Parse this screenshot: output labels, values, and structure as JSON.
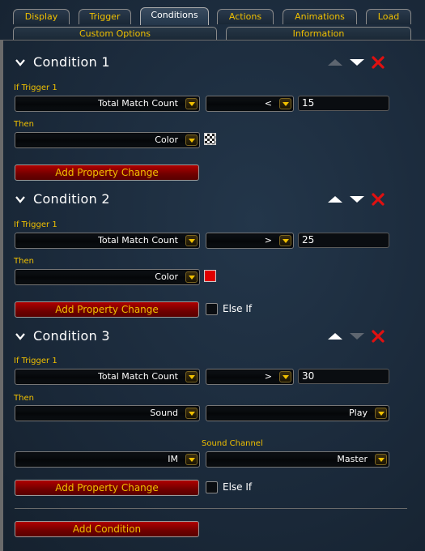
{
  "tabs": [
    "Display",
    "Trigger",
    "Conditions",
    "Actions",
    "Animations",
    "Load"
  ],
  "subtabs": [
    "Custom Options",
    "Information"
  ],
  "conditions": [
    {
      "title": "Condition 1",
      "if_label": "If Trigger 1",
      "check": "Total Match Count",
      "operator": "<",
      "value": "15",
      "then_label": "Then",
      "property": "Color",
      "swatch": "checker",
      "add_label": "Add Property Change"
    },
    {
      "title": "Condition 2",
      "if_label": "If Trigger 1",
      "check": "Total Match Count",
      "operator": ">",
      "value": "25",
      "then_label": "Then",
      "property": "Color",
      "swatch": "#e00000",
      "add_label": "Add Property Change",
      "else_if": "Else If"
    },
    {
      "title": "Condition 3",
      "if_label": "If Trigger 1",
      "check": "Total Match Count",
      "operator": ">",
      "value": "30",
      "then_label": "Then",
      "property": "Sound",
      "action": "Play",
      "channel_label": "Sound Channel",
      "sound_value": "IM",
      "channel_value": "Master",
      "add_label": "Add Property Change",
      "else_if": "Else If"
    }
  ],
  "add_condition": "Add Condition",
  "colors": {
    "accent_yellow": "#f0c000",
    "button_red": "#b00000",
    "delete_red": "#e01010"
  }
}
